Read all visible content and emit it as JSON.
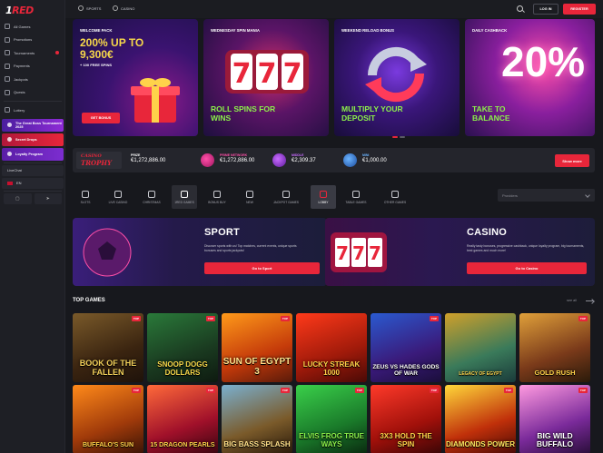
{
  "brand": {
    "logo_one": "1",
    "logo_red": "RED"
  },
  "header": {
    "tab_sports": "SPORTS",
    "tab_casino": "CASINO",
    "login": "LOG IN",
    "register": "REGISTER"
  },
  "sidebar": {
    "items": [
      {
        "label": "All Games",
        "icon": "grid-icon"
      },
      {
        "label": "Promotions",
        "icon": "gift-icon"
      },
      {
        "label": "Tournaments",
        "icon": "trophy-icon"
      },
      {
        "label": "Payments",
        "icon": "card-icon"
      },
      {
        "label": "Jackpots",
        "icon": "coins-icon"
      },
      {
        "label": "Quests",
        "icon": "target-icon"
      },
      {
        "label": "Lottery",
        "icon": "ticket-icon"
      }
    ],
    "promos": [
      "The Great Boss Tournament 2025",
      "Secret Drops",
      "Loyalty Program"
    ],
    "livechat": "LiveChat",
    "language": "EN"
  },
  "banners": [
    {
      "tag": "WELCOME PACK",
      "big": "200% UP TO 9,300€",
      "sub": "+ 100 FREE SPINS",
      "button": "GET BONUS"
    },
    {
      "tag": "WEDNESDAY SPIN MANIA",
      "big": "ROLL SPINS FOR WINS"
    },
    {
      "tag": "WEEKEND RELOAD BONUS",
      "big": "MULTIPLY YOUR DEPOSIT"
    },
    {
      "tag": "DAILY CASHBACK",
      "big": "TAKE TO BALANCE",
      "percent": "20%"
    }
  ],
  "jackpot": {
    "logo_top": "CASINO",
    "logo_bottom": "TROPHY",
    "prize_label": "PRIZE",
    "prize_value": "€1,272,886.00",
    "cols": [
      {
        "label": "PRIME NETWORK",
        "value": "€1,272,886.00"
      },
      {
        "label": "MIDDLE",
        "value": "€2,309.37"
      },
      {
        "label": "MINI",
        "value": "€1,000.00"
      }
    ],
    "button": "Show more"
  },
  "categories": [
    "SLOTS",
    "LIVE CASINO",
    "CHRISTMAS",
    "1RED GAMES",
    "BONUS BUY",
    "NEW",
    "JACKPOT GAMES",
    "LOBBY",
    "TABLE GAMES",
    "OTHER GAMES"
  ],
  "providers_placeholder": "Providers",
  "sport": {
    "title": "SPORT",
    "text": "Discover sports with us! Top matches, current events, unique sports bonuses and sports jackpots!",
    "button": "Go to Sport"
  },
  "casino": {
    "title": "CASINO",
    "text": "Really tasty bonuses, progressive cashback, unique loyalty program, big tournaments, best games and much more!",
    "button": "Go to Casino"
  },
  "top_games": {
    "title": "TOP GAMES",
    "see_all": "see all",
    "games": [
      {
        "name": "BOOK OF THE FALLEN"
      },
      {
        "name": "SNOOP DOGG DOLLARS"
      },
      {
        "name": "SUN OF EGYPT 3"
      },
      {
        "name": "LUCKY STREAK 1000"
      },
      {
        "name": "ZEUS VS HADES GODS OF WAR"
      },
      {
        "name": "LEGACY OF EGYPT"
      },
      {
        "name": "GOLD RUSH"
      },
      {
        "name": "BUFFALO'S SUN"
      },
      {
        "name": "15 DRAGON PEARLS"
      },
      {
        "name": "BIG BASS SPLASH"
      },
      {
        "name": "ELVIS FROG TRUE WAYS"
      },
      {
        "name": "3X3 HOLD THE SPIN"
      },
      {
        "name": "DIAMONDS POWER"
      },
      {
        "name": "BIG WILD BUFFALO"
      }
    ],
    "badge": "TOP"
  },
  "colors": {
    "accent": "#e8263a",
    "bg": "#17181d",
    "sidebar": "#1e1f25"
  }
}
